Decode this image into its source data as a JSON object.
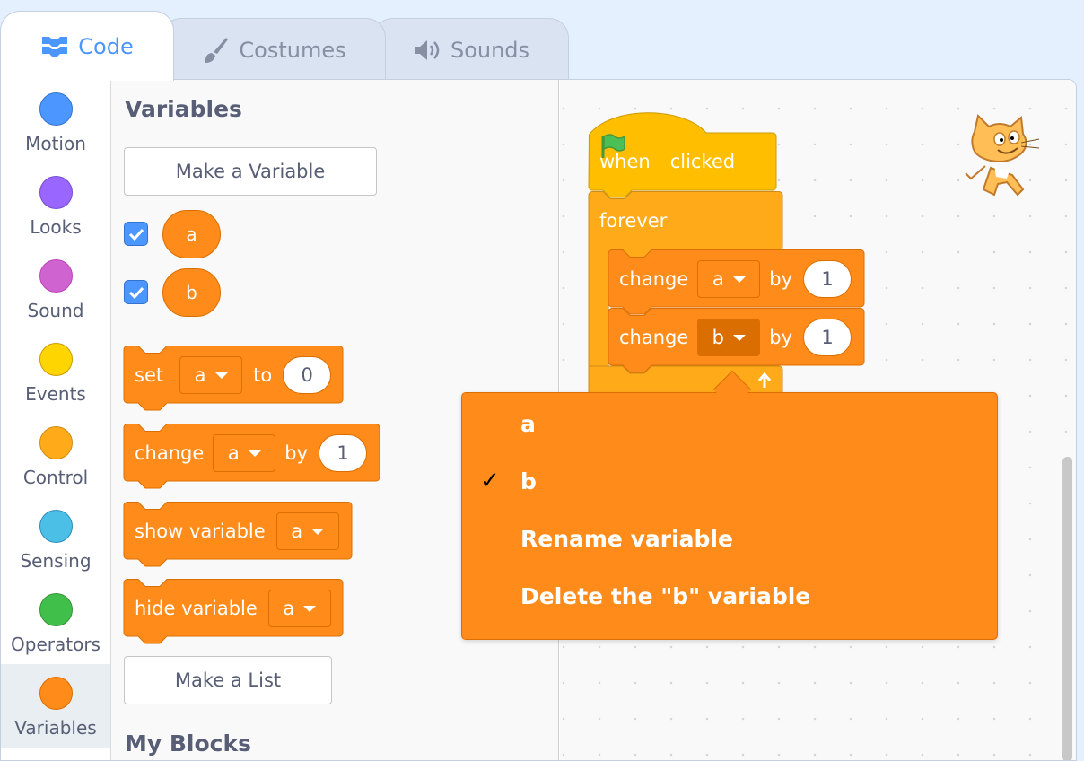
{
  "tabs": [
    {
      "label": "Code",
      "icon": "code-icon"
    },
    {
      "label": "Costumes",
      "icon": "brush-icon"
    },
    {
      "label": "Sounds",
      "icon": "speaker-icon"
    }
  ],
  "categories": [
    {
      "label": "Motion",
      "color": "#4c97ff"
    },
    {
      "label": "Looks",
      "color": "#9966ff"
    },
    {
      "label": "Sound",
      "color": "#cf63cf"
    },
    {
      "label": "Events",
      "color": "#ffd500"
    },
    {
      "label": "Control",
      "color": "#ffab19"
    },
    {
      "label": "Sensing",
      "color": "#4cbfe6"
    },
    {
      "label": "Operators",
      "color": "#40bf4a"
    },
    {
      "label": "Variables",
      "color": "#ff8c1a",
      "selected": true
    }
  ],
  "palette": {
    "section_title": "Variables",
    "make_variable": "Make a Variable",
    "variables": [
      {
        "name": "a",
        "checked": true
      },
      {
        "name": "b",
        "checked": true
      }
    ],
    "blocks": {
      "set": {
        "label": "set",
        "var": "a",
        "to_label": "to",
        "value": "0"
      },
      "change": {
        "label": "change",
        "var": "a",
        "by_label": "by",
        "value": "1"
      },
      "show": {
        "label": "show variable",
        "var": "a"
      },
      "hide": {
        "label": "hide variable",
        "var": "a"
      }
    },
    "make_list": "Make a List",
    "my_blocks_title": "My Blocks"
  },
  "script": {
    "hat": {
      "when": "when",
      "clicked": "clicked"
    },
    "forever": "forever",
    "change1": {
      "label": "change",
      "var": "a",
      "by": "by",
      "value": "1"
    },
    "change2": {
      "label": "change",
      "var": "b",
      "by": "by",
      "value": "1"
    }
  },
  "dropdown": {
    "items": [
      {
        "label": "a",
        "checked": false
      },
      {
        "label": "b",
        "checked": true
      },
      {
        "label": "Rename variable",
        "checked": false
      },
      {
        "label": "Delete the \"b\" variable",
        "checked": false
      }
    ],
    "checkmark": "✓"
  },
  "colors": {
    "variables": "#ff8c1a",
    "variables_dark": "#db6e00",
    "events": "#ffbf00",
    "control": "#ffab19",
    "accent": "#4c97ff"
  }
}
